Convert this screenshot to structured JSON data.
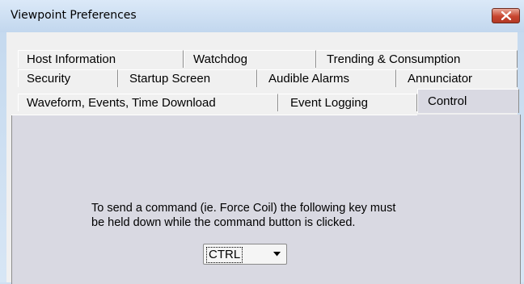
{
  "window": {
    "title": "Viewpoint Preferences"
  },
  "tabs": {
    "row1": [
      {
        "label": "Host Information"
      },
      {
        "label": "Watchdog"
      },
      {
        "label": "Trending & Consumption"
      }
    ],
    "row2": [
      {
        "label": "Security"
      },
      {
        "label": "Startup Screen"
      },
      {
        "label": "Audible Alarms"
      },
      {
        "label": "Annunciator"
      }
    ],
    "row3": [
      {
        "label": "Waveform, Events, Time Download"
      },
      {
        "label": "Event Logging"
      },
      {
        "label": "Control",
        "selected": true
      }
    ]
  },
  "control_page": {
    "message_line1": "To send a command (ie. Force Coil) the following key must",
    "message_line2": "be held down while the command button is clicked.",
    "key_select": {
      "value": "CTRL"
    }
  },
  "icons": {
    "close": "close-x-icon",
    "dropdown": "dropdown-arrow-icon"
  },
  "colors": {
    "close_button": "#c8452f",
    "panel": "#d9d9e2"
  }
}
